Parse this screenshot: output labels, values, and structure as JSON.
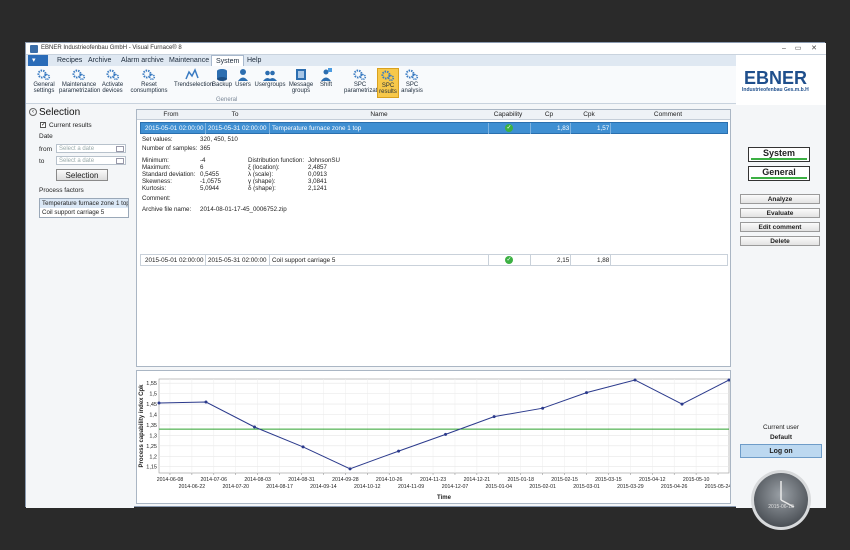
{
  "window": {
    "title": "EBNER Industrieofenbau GmbH - Visual Furnace® 8"
  },
  "menu": {
    "items": [
      "Recipes",
      "Archive",
      "Alarm archive",
      "Maintenance",
      "System",
      "Help"
    ],
    "active": "System"
  },
  "ribbon": {
    "group_label": "General",
    "buttons": [
      {
        "label": "General\nsettings",
        "icon": "gears-icon"
      },
      {
        "label": "Maintenance\nparametrization",
        "icon": "gears-icon"
      },
      {
        "label": "Activate\ndevices",
        "icon": "gears-icon"
      },
      {
        "label": "Reset\nconsumptions",
        "icon": "gears-icon"
      },
      {
        "label": "Trendselection",
        "icon": "trend-icon"
      },
      {
        "label": "Backup",
        "icon": "database-icon"
      },
      {
        "label": "Users",
        "icon": "user-icon"
      },
      {
        "label": "Usergroups",
        "icon": "usergroup-icon"
      },
      {
        "label": "Message\ngroups",
        "icon": "speaker-icon"
      },
      {
        "label": "Shift",
        "icon": "shift-icon"
      },
      {
        "label": "SPC\nparametrization",
        "icon": "gears-icon"
      },
      {
        "label": "SPC\nresults",
        "icon": "gears-icon",
        "selected": true
      },
      {
        "label": "SPC\nanalysis",
        "icon": "gears-icon"
      }
    ]
  },
  "logo": {
    "text": "EBNER",
    "subtext": "Industrieofenbau Ges.m.b.H"
  },
  "selection": {
    "heading": "Selection",
    "current_results_label": "Current results",
    "current_results_checked": true,
    "date_label": "Date",
    "from_label": "from",
    "to_label": "to",
    "from_placeholder": "Select a date",
    "to_placeholder": "Select a date",
    "selection_button": "Selection",
    "process_factors_label": "Process factors",
    "process_factors": [
      "Temperature furnace zone 1 top",
      "Coil support carriage 5"
    ]
  },
  "table": {
    "columns": [
      "From",
      "To",
      "Name",
      "Capability",
      "Cp",
      "Cpk",
      "Comment"
    ],
    "rows": [
      {
        "from": "2015-05-01 02:00:00",
        "to": "2015-05-31 02:00:00",
        "name": "Temperature furnace zone 1 top",
        "capability": "ok",
        "cp": "1,83",
        "cpk": "1,57",
        "comment": ""
      },
      {
        "from": "2015-05-01 02:00:00",
        "to": "2015-05-31 02:00:00",
        "name": "Coil support carriage 5",
        "capability": "ok",
        "cp": "2,15",
        "cpk": "1,88",
        "comment": ""
      }
    ],
    "details": {
      "set_values_label": "Set values:",
      "set_values": "320, 450, 510",
      "num_samples_label": "Number of samples:",
      "num_samples": "365",
      "minimum_label": "Minimum:",
      "minimum": "-4",
      "maximum_label": "Maximum:",
      "maximum": "6",
      "std_label": "Standard deviation:",
      "std": "0,5455",
      "skew_label": "Skewness:",
      "skew": "-1,0575",
      "kurt_label": "Kurtosis:",
      "kurt": "5,0944",
      "dist_label": "Distribution function:",
      "dist": "JohnsonSU",
      "xi_label": "ξ (location):",
      "xi": "2,4857",
      "lambda_label": "λ (scale):",
      "lambda": "0,0913",
      "gamma_label": "γ (shape):",
      "gamma": "3,0841",
      "delta_label": "δ (shape):",
      "delta": "2,1241",
      "comment_label": "Comment:",
      "archive_label": "Archive file name:",
      "archive": "2014-08-01-17-45_0006752.zip"
    }
  },
  "chart_data": {
    "type": "line",
    "xlabel": "Time",
    "ylabel": "Process capability index Cpk",
    "ylim": [
      1.12,
      1.57
    ],
    "yticks": [
      "1,15",
      "1,2",
      "1,25",
      "1,3",
      "1,35",
      "1,4",
      "1,45",
      "1,5",
      "1,55"
    ],
    "xticks_top": [
      "2014-06-08",
      "2014-07-06",
      "2014-08-03",
      "2014-08-31",
      "2014-09-28",
      "2014-10-26",
      "2014-11-23",
      "2014-12-21",
      "2015-01-18",
      "2015-02-15",
      "2015-03-15",
      "2015-04-12",
      "2015-05-10"
    ],
    "xticks_bottom": [
      "2014-06-22",
      "2014-07-20",
      "2014-08-17",
      "2014-09-14",
      "2014-10-12",
      "2014-11-09",
      "2014-12-07",
      "2015-01-04",
      "2015-02-01",
      "2015-03-01",
      "2015-03-29",
      "2015-04-26",
      "2015-05-24"
    ],
    "x": [
      "2014-06-01",
      "2014-07-01",
      "2014-08-01",
      "2014-09-01",
      "2014-10-01",
      "2014-11-01",
      "2014-12-01",
      "2015-01-01",
      "2015-02-01",
      "2015-03-01",
      "2015-04-01",
      "2015-05-01",
      "2015-05-31"
    ],
    "series": [
      {
        "values": [
          1.455,
          1.46,
          1.34,
          1.245,
          1.14,
          1.225,
          1.305,
          1.39,
          1.43,
          1.505,
          1.565,
          1.45,
          1.565
        ],
        "color": "#2b3a8c"
      }
    ],
    "reference_line": {
      "value": 1.33,
      "color": "#2ca02c"
    },
    "grid": true
  },
  "right_panel": {
    "system_button": "System",
    "general_button": "General",
    "actions": [
      "Analyze",
      "Evaluate",
      "Edit comment",
      "Delete"
    ],
    "current_user_label": "Current user",
    "current_user": "Default",
    "login_button": "Log on",
    "clock_date": "2015-06-10"
  }
}
